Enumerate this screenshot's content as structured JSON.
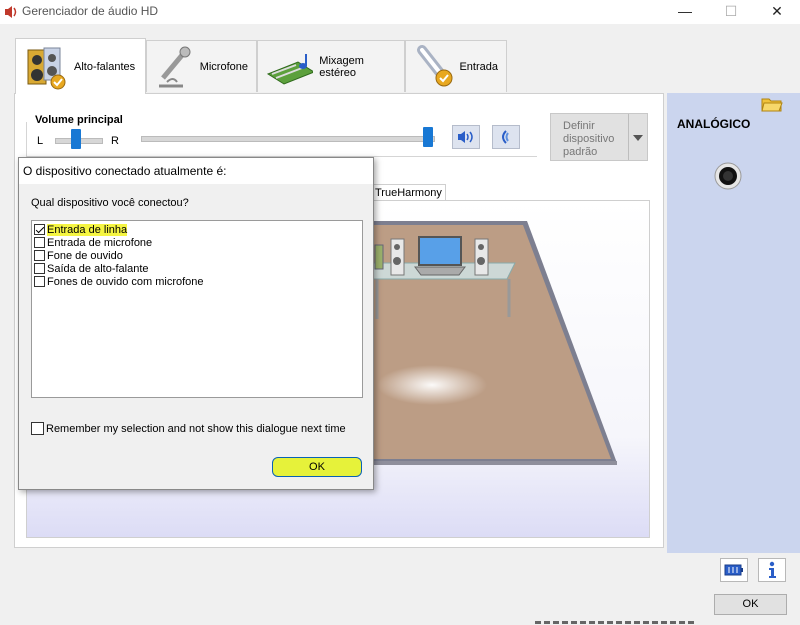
{
  "window": {
    "title": "Gerenciador de áudio HD",
    "minimize": "—",
    "maximize": "☐",
    "close": "✕"
  },
  "tabs": [
    {
      "label": "Alto-falantes",
      "icon": "speaker-icon"
    },
    {
      "label": "Microfone",
      "icon": "microphone-icon"
    },
    {
      "label": "Mixagem estéreo",
      "icon": "mixer-icon"
    },
    {
      "label": "Entrada",
      "icon": "input-icon"
    }
  ],
  "volume": {
    "title": "Volume principal",
    "left": "L",
    "right": "R",
    "balance_position": 0.45,
    "level": 1.0
  },
  "default_device_button": "Definir dispositivo padrão",
  "subtab": "TrueHarmony",
  "right_panel": {
    "title": "ANALÓGICO",
    "folder_icon": "folder-icon",
    "jack_icon": "audio-jack-icon"
  },
  "dialog": {
    "title": "O dispositivo conectado atualmente é:",
    "question": "Qual dispositivo você conectou?",
    "devices": [
      {
        "label": "Entrada de linha",
        "checked": true
      },
      {
        "label": "Entrada de microfone",
        "checked": false
      },
      {
        "label": "Fone de ouvido",
        "checked": false
      },
      {
        "label": "Saída de alto-falante",
        "checked": false
      },
      {
        "label": "Fones de ouvido com microfone",
        "checked": false
      }
    ],
    "remember_label": "Remember my selection and not show this dialogue next time",
    "remember_checked": false,
    "ok": "OK"
  },
  "main_ok": "OK",
  "colors": {
    "accent": "#1878d4",
    "highlight": "#f5f542",
    "right_panel": "#cbd5ee"
  }
}
